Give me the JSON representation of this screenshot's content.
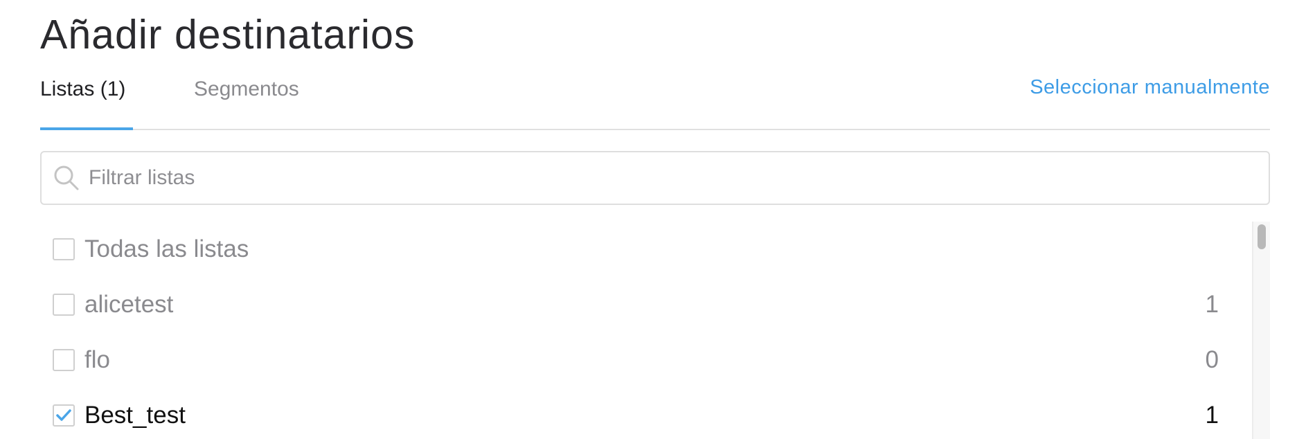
{
  "header": {
    "title": "Añadir destinatarios"
  },
  "tabs": [
    {
      "label": "Listas (1)",
      "active": true
    },
    {
      "label": "Segmentos",
      "active": false
    }
  ],
  "manual_link": "Seleccionar manualmente",
  "search": {
    "placeholder": "Filtrar listas",
    "value": ""
  },
  "lists": [
    {
      "label": "Todas las listas",
      "count": "",
      "checked": false
    },
    {
      "label": "alicetest",
      "count": "1",
      "checked": false
    },
    {
      "label": "flo",
      "count": "0",
      "checked": false
    },
    {
      "label": "Best_test",
      "count": "1",
      "checked": true
    }
  ],
  "colors": {
    "accent": "#4aa5e8",
    "link": "#3d9ce6",
    "muted_text": "#8a8a8e",
    "title_text": "#2a2a2e"
  },
  "icons": {
    "search": "search-icon",
    "check": "checkmark-icon"
  }
}
